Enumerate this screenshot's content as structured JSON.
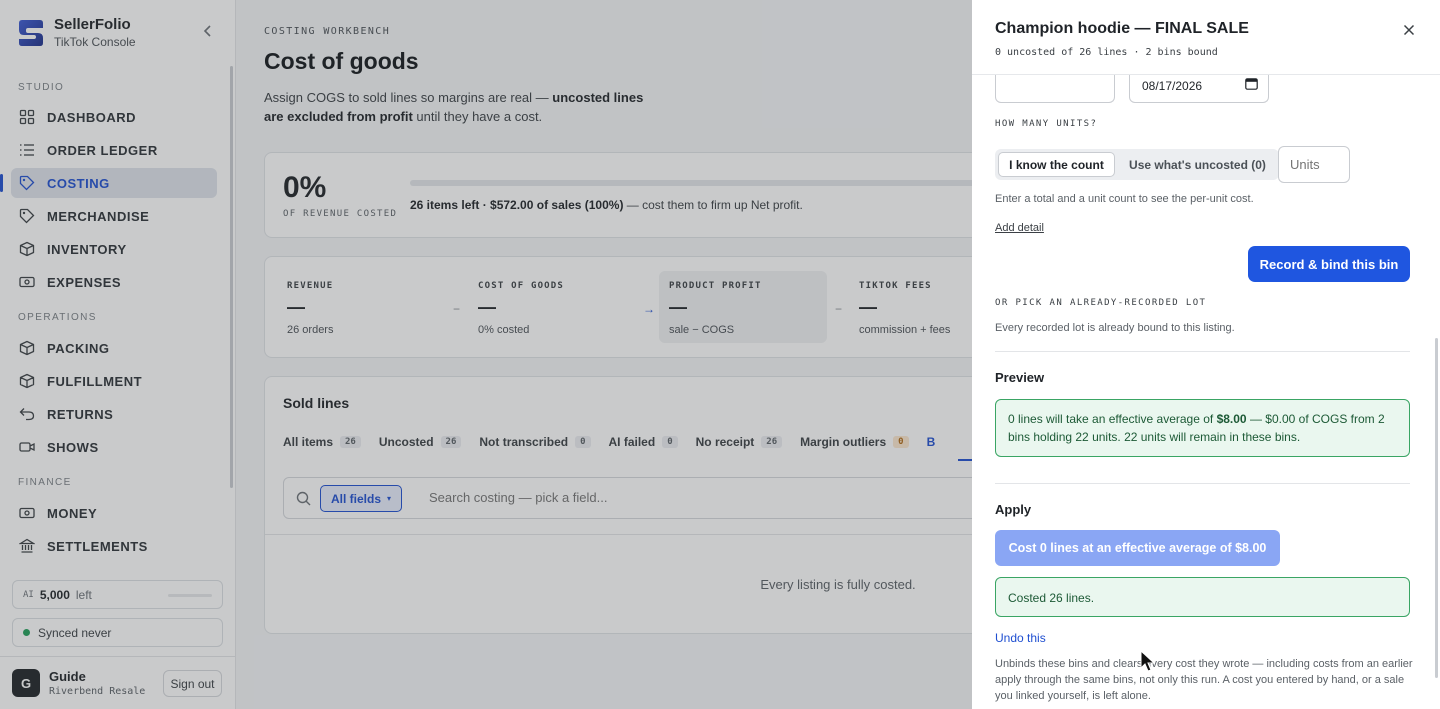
{
  "brand": {
    "name": "SellerFolio",
    "sub": "TikTok Console"
  },
  "nav": {
    "sections": {
      "studio": "STUDIO",
      "operations": "OPERATIONS",
      "finance": "FINANCE"
    },
    "items": [
      {
        "label": "DASHBOARD",
        "icon": "grid-icon"
      },
      {
        "label": "ORDER LEDGER",
        "icon": "list-icon"
      },
      {
        "label": "COSTING",
        "icon": "tag-icon"
      },
      {
        "label": "MERCHANDISE",
        "icon": "tag-icon"
      },
      {
        "label": "INVENTORY",
        "icon": "box-icon"
      },
      {
        "label": "EXPENSES",
        "icon": "banknote-icon"
      },
      {
        "label": "PACKING",
        "icon": "box-icon"
      },
      {
        "label": "FULFILLMENT",
        "icon": "box-icon"
      },
      {
        "label": "RETURNS",
        "icon": "return-icon"
      },
      {
        "label": "SHOWS",
        "icon": "video-icon"
      },
      {
        "label": "MONEY",
        "icon": "banknote-icon"
      },
      {
        "label": "SETTLEMENTS",
        "icon": "bank-icon"
      }
    ]
  },
  "ai": {
    "tag": "AI",
    "count": "5,000",
    "suffix": "left"
  },
  "sync": {
    "text": "Synced never"
  },
  "user": {
    "initial": "G",
    "name": "Guide",
    "org": "Riverbend Resale",
    "signout": "Sign out"
  },
  "page": {
    "eyebrow": "COSTING WORKBENCH",
    "title": "Cost of goods",
    "lede_a": "Assign COGS to sold lines so margins are real — ",
    "lede_b": "uncosted lines are excluded from profit",
    "lede_c": " until they have a cost."
  },
  "coverage": {
    "pct": "0%",
    "label": "OF REVENUE COSTED",
    "bold": "26 items left · $572.00 of sales (100%)",
    "rest": " — cost them to firm up Net profit.",
    "progress": 0
  },
  "metrics": [
    {
      "label": "REVENUE",
      "value": "—",
      "sub": "26 orders"
    },
    {
      "label": "COST OF GOODS",
      "value": "—",
      "sub": "0% costed"
    },
    {
      "label": "PRODUCT PROFIT",
      "value": "—",
      "sub": "sale − COGS"
    },
    {
      "label": "TIKTOK FEES",
      "value": "—",
      "sub": "commission + fees"
    }
  ],
  "ops": {
    "minus": "−",
    "arrow": "→"
  },
  "sold": {
    "title": "Sold lines",
    "tabs": [
      {
        "label": "All items",
        "count": "26"
      },
      {
        "label": "Uncosted",
        "count": "26"
      },
      {
        "label": "Not transcribed",
        "count": "0"
      },
      {
        "label": "AI failed",
        "count": "0"
      },
      {
        "label": "No receipt",
        "count": "26"
      },
      {
        "label": "Margin outliers",
        "count": "0"
      },
      {
        "label": "B",
        "count": ""
      }
    ],
    "field_chip": "All fields",
    "search_placeholder": "Search costing — pick a field...",
    "empty": "Every listing is fully costed."
  },
  "drawer": {
    "title": "Champion hoodie — FINAL SALE",
    "sub": "0 uncosted of 26 lines · 2 bins bound",
    "date_value": "08/17/2026",
    "units_caption": "HOW MANY UNITS?",
    "seg_a": "I know the count",
    "seg_b": "Use what's uncosted (0)",
    "units_placeholder": "Units",
    "hint": "Enter a total and a unit count to see the per-unit cost.",
    "add_detail": "Add detail",
    "record_btn": "Record & bind this bin",
    "pick_caption": "OR PICK AN ALREADY-RECORDED LOT",
    "pick_hint": "Every recorded lot is already bound to this listing.",
    "preview_title": "Preview",
    "preview_a": "0 lines will take an effective average of ",
    "preview_b": "$8.00",
    "preview_c": " — $0.00 of COGS from 2 bins holding 22 units. 22 units will remain in these bins.",
    "apply_title": "Apply",
    "apply_btn": "Cost 0 lines at an effective average of $8.00",
    "costed": "Costed 26 lines.",
    "undo": "Undo this",
    "fine": "Unbinds these bins and clears every cost they wrote — including costs from an earlier apply through the same bins, not only this run. A cost you entered by hand, or a sale you linked yourself, is left alone."
  }
}
